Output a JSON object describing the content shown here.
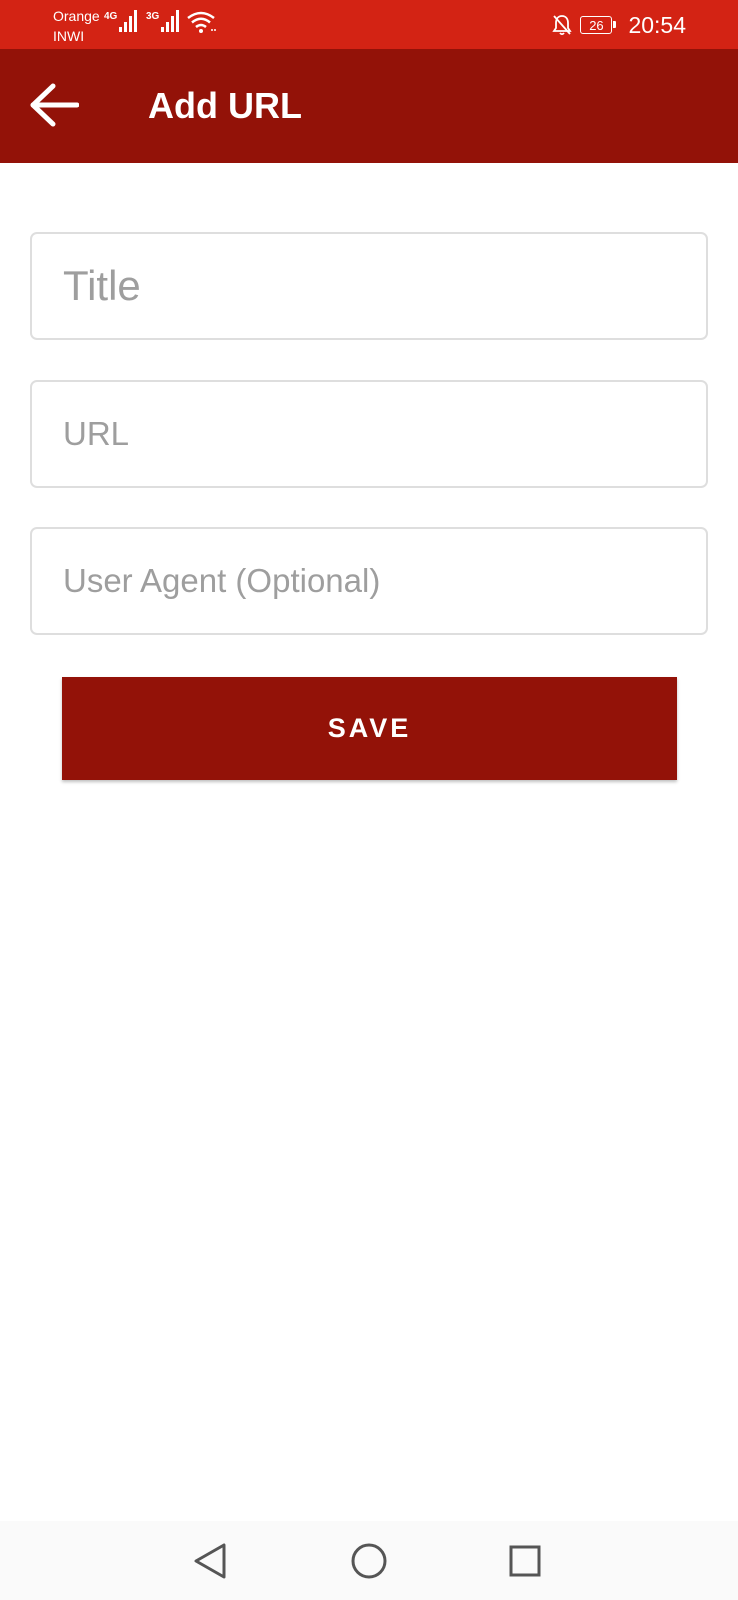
{
  "status_bar": {
    "carrier_primary": "Orange",
    "carrier_secondary": "INWI",
    "network_1": "4G",
    "network_2": "3G",
    "battery_level": "26",
    "time": "20:54",
    "icons": [
      "signal-icon",
      "signal-icon",
      "wifi-icon",
      "bell-off-icon",
      "battery-icon"
    ]
  },
  "app_bar": {
    "title": "Add URL",
    "back_icon": "arrow-left-icon"
  },
  "form": {
    "title_placeholder": "Title",
    "title_value": "",
    "url_placeholder": "URL",
    "url_value": "",
    "user_agent_placeholder": "User Agent (Optional)",
    "user_agent_value": ""
  },
  "actions": {
    "save_label": "SAVE"
  },
  "nav_bar": {
    "icons": [
      "triangle-back-icon",
      "circle-home-icon",
      "square-recents-icon"
    ]
  },
  "colors": {
    "status_bar": "#d32314",
    "app_bar": "#931208",
    "button": "#931208",
    "placeholder": "#9e9e9e",
    "field_border": "#dedede"
  }
}
